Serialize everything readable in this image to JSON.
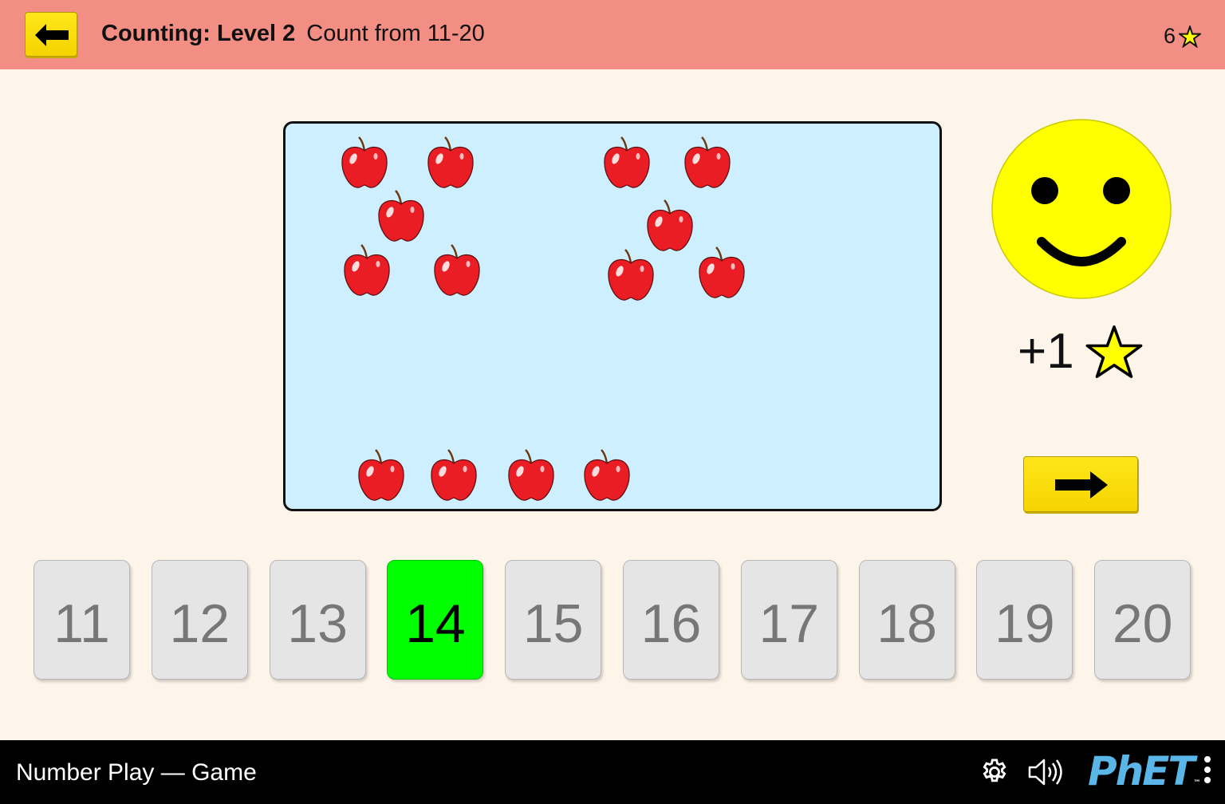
{
  "header": {
    "back_icon": "left-arrow-icon",
    "title_level": "Counting: Level 2",
    "title_desc": "Count from 11-20",
    "score": "6",
    "score_icon": "star-outline-icon",
    "bg_color": "#f28e84"
  },
  "play_area": {
    "object_icon": "apple-icon",
    "object_count": 14,
    "bg_color": "#cdefff"
  },
  "feedback": {
    "face_icon": "smiley-face-icon",
    "points_text": "+1",
    "points_icon": "star-icon"
  },
  "next_button": {
    "icon": "right-arrow-icon"
  },
  "answers": {
    "buttons": [
      "11",
      "12",
      "13",
      "14",
      "15",
      "16",
      "17",
      "18",
      "19",
      "20"
    ],
    "selected": "14",
    "selected_color": "#00ff00"
  },
  "navbar": {
    "sim_title": "Number Play — Game",
    "settings_icon": "gear-icon",
    "sound_icon": "speaker-icon",
    "logo_text": "PhET",
    "menu_icon": "kebab-menu-icon"
  }
}
